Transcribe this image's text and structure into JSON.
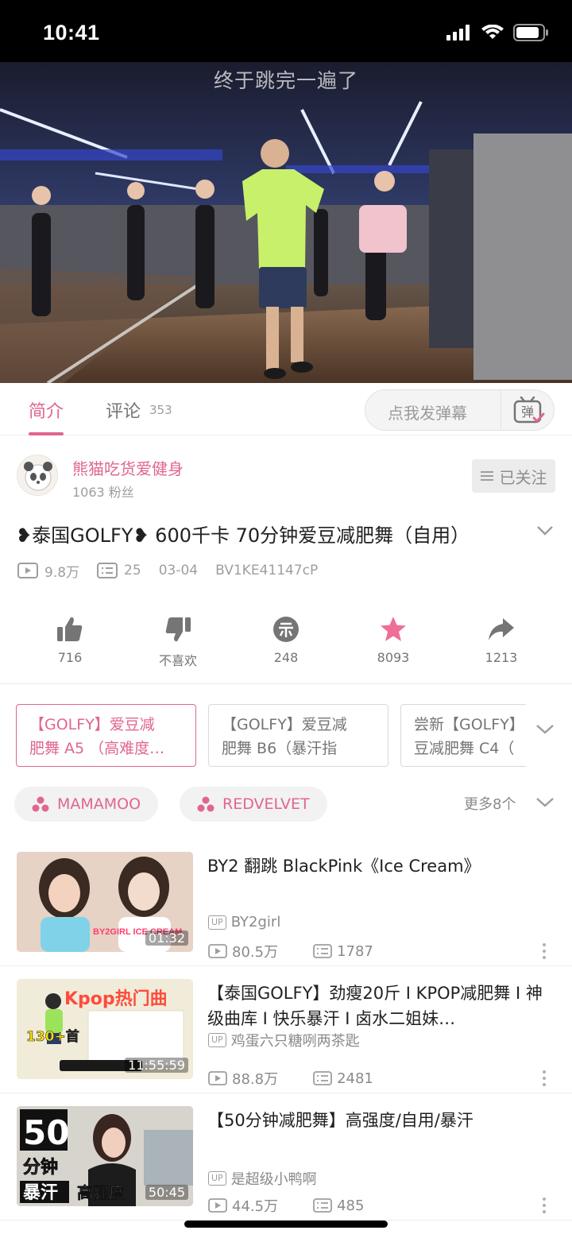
{
  "status_bar": {
    "time": "10:41"
  },
  "video": {
    "subtitle": "终于跳完一遍了"
  },
  "tabs": {
    "intro": "简介",
    "comments": "评论",
    "comment_count": "353"
  },
  "danmaku": {
    "placeholder": "点我发弹幕",
    "icon_label": "弹"
  },
  "uploader": {
    "name": "熊猫吃货爱健身",
    "fans": "1063 粉丝",
    "follow_label": "已关注"
  },
  "video_info": {
    "title": "❥泰国GOLFY❥ 600千卡 70分钟爱豆减肥舞（自用）",
    "views": "9.8万",
    "danmaku_count": "25",
    "date": "03-04",
    "bvid": "BV1KE41147cP"
  },
  "actions": {
    "like": "716",
    "dislike": "不喜欢",
    "coin": "248",
    "favorite": "8093",
    "share": "1213"
  },
  "episodes": [
    {
      "line1": "【GOLFY】爱豆减",
      "line2": "肥舞 A5 （高难度…"
    },
    {
      "line1": "【GOLFY】爱豆减",
      "line2": "肥舞 B6（暴汗指"
    },
    {
      "line1": "尝新【GOLFY】",
      "line2": "豆减肥舞 C4（"
    }
  ],
  "tags": [
    "MAMAMOO",
    "REDVELVET"
  ],
  "more_tags": "更多8个",
  "recommendations": [
    {
      "title": "BY2 翻跳 BlackPink《Ice Cream》",
      "uploader": "BY2girl",
      "up_badge": "UP",
      "views": "80.5万",
      "danmaku": "1787",
      "duration": "01:32",
      "thumb_text": "BY2GIRL ICE CREAM"
    },
    {
      "title": "【泰国GOLFY】劲瘦20斤 I KPOP减肥舞 I 神级曲库 I 快乐暴汗 I 卤水二姐妹…",
      "uploader": "鸡蛋六只糖咧两茶匙",
      "up_badge": "UP",
      "views": "88.8万",
      "danmaku": "2481",
      "duration": "11:55:59",
      "thumb_text": "Kpop热门曲",
      "thumb_badge": "130+首"
    },
    {
      "title": "【50分钟减肥舞】高强度/自用/暴汗",
      "uploader": "是超级小鸭啊",
      "up_badge": "UP",
      "views": "44.5万",
      "danmaku": "485",
      "duration": "50:45",
      "thumb_big": "50",
      "thumb_line2": "分钟",
      "thumb_line3": "暴汗",
      "thumb_line4": "高强度"
    }
  ],
  "colors": {
    "accent": "#e0668f",
    "muted": "#9e9e9e"
  }
}
